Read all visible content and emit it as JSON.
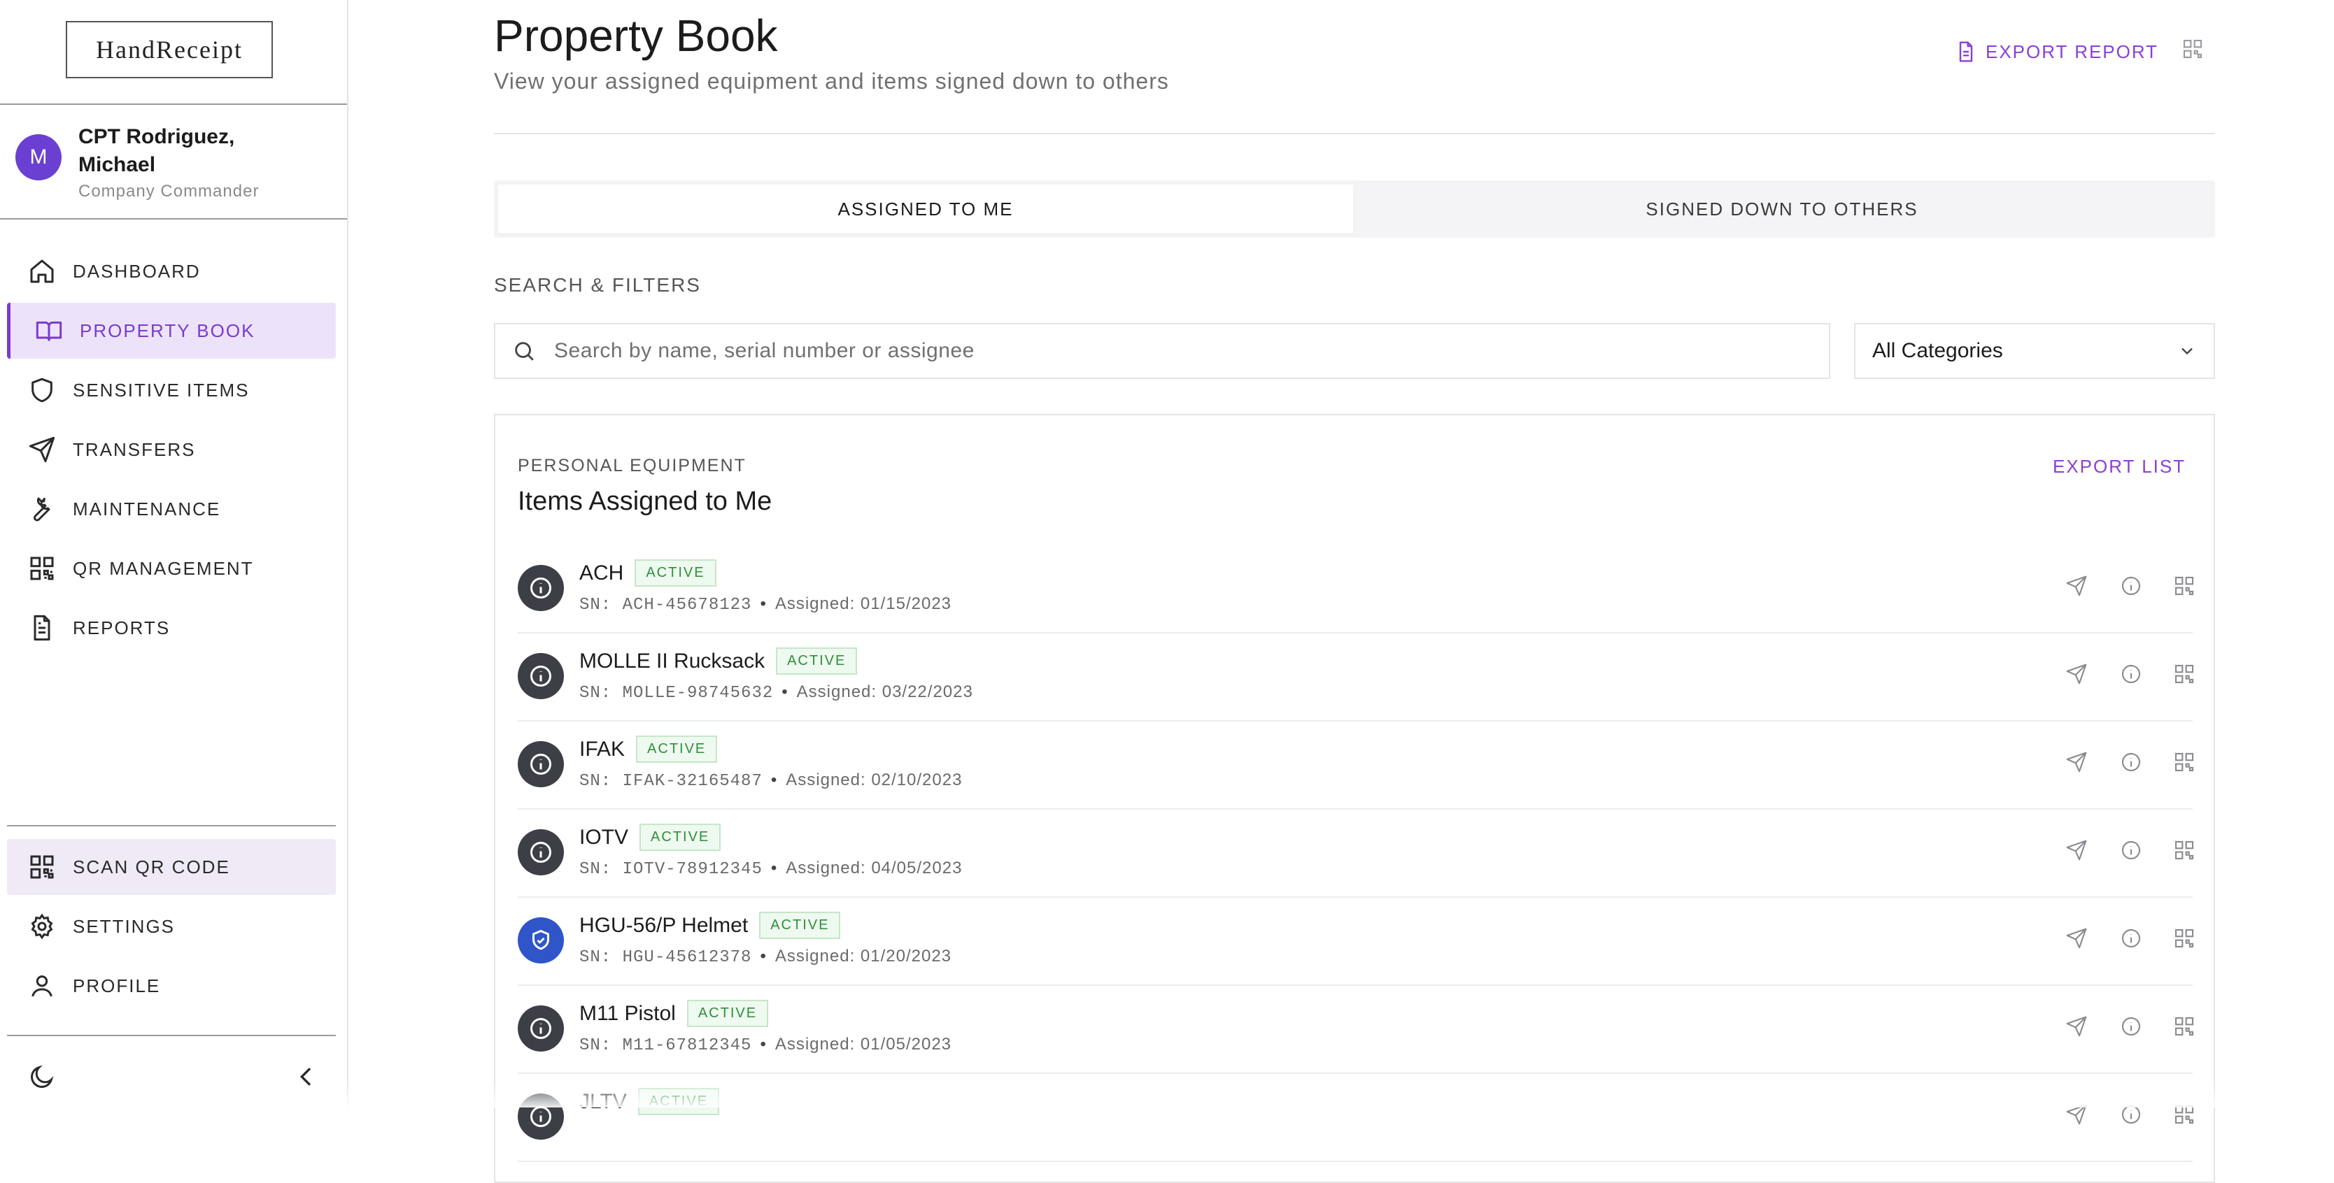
{
  "app": {
    "logo_text": "HandReceipt"
  },
  "user": {
    "initial": "M",
    "name": "CPT Rodriguez, Michael",
    "role": "Company Commander"
  },
  "nav": {
    "items": [
      {
        "label": "DASHBOARD",
        "icon": "home-icon"
      },
      {
        "label": "PROPERTY BOOK",
        "icon": "book-icon",
        "active": true
      },
      {
        "label": "SENSITIVE ITEMS",
        "icon": "shield-icon"
      },
      {
        "label": "TRANSFERS",
        "icon": "send-icon"
      },
      {
        "label": "MAINTENANCE",
        "icon": "wrench-icon"
      },
      {
        "label": "QR MANAGEMENT",
        "icon": "qr-icon"
      },
      {
        "label": "REPORTS",
        "icon": "document-icon"
      }
    ],
    "bottom": [
      {
        "label": "SCAN QR CODE",
        "icon": "qr-icon"
      },
      {
        "label": "SETTINGS",
        "icon": "gear-icon"
      },
      {
        "label": "PROFILE",
        "icon": "user-icon"
      }
    ]
  },
  "page": {
    "title": "Property Book",
    "subtitle": "View your assigned equipment and items signed down to others",
    "export_report": "EXPORT REPORT"
  },
  "tabs": [
    {
      "label": "ASSIGNED TO ME",
      "selected": true
    },
    {
      "label": "SIGNED DOWN TO OTHERS",
      "selected": false
    }
  ],
  "filters": {
    "heading": "SEARCH & FILTERS",
    "search_placeholder": "Search by name, serial number or assignee",
    "category_selected": "All Categories"
  },
  "card": {
    "overline": "PERSONAL EQUIPMENT",
    "title": "Items Assigned to Me",
    "export_list": "EXPORT LIST",
    "items": [
      {
        "name": "ACH",
        "status": "ACTIVE",
        "sn": "SN: ACH-45678123",
        "assigned": "Assigned: 01/15/2023",
        "icon": "info-icon"
      },
      {
        "name": "MOLLE II Rucksack",
        "status": "ACTIVE",
        "sn": "SN: MOLLE-98745632",
        "assigned": "Assigned: 03/22/2023",
        "icon": "info-icon"
      },
      {
        "name": "IFAK",
        "status": "ACTIVE",
        "sn": "SN: IFAK-32165487",
        "assigned": "Assigned: 02/10/2023",
        "icon": "info-icon"
      },
      {
        "name": "IOTV",
        "status": "ACTIVE",
        "sn": "SN: IOTV-78912345",
        "assigned": "Assigned: 04/05/2023",
        "icon": "info-icon"
      },
      {
        "name": "HGU-56/P Helmet",
        "status": "ACTIVE",
        "sn": "SN: HGU-45612378",
        "assigned": "Assigned: 01/20/2023",
        "icon": "shield-check-icon"
      },
      {
        "name": "M11 Pistol",
        "status": "ACTIVE",
        "sn": "SN: M11-67812345",
        "assigned": "Assigned: 01/05/2023",
        "icon": "info-icon"
      },
      {
        "name": "JLTV",
        "status": "ACTIVE",
        "sn": "",
        "assigned": "",
        "icon": "info-icon"
      }
    ]
  },
  "colors": {
    "accent": "#7a3ad1",
    "active_badge": "#2f8f3a",
    "row_icon": "#3c3f46",
    "sensitive_icon": "#2f55c9"
  }
}
